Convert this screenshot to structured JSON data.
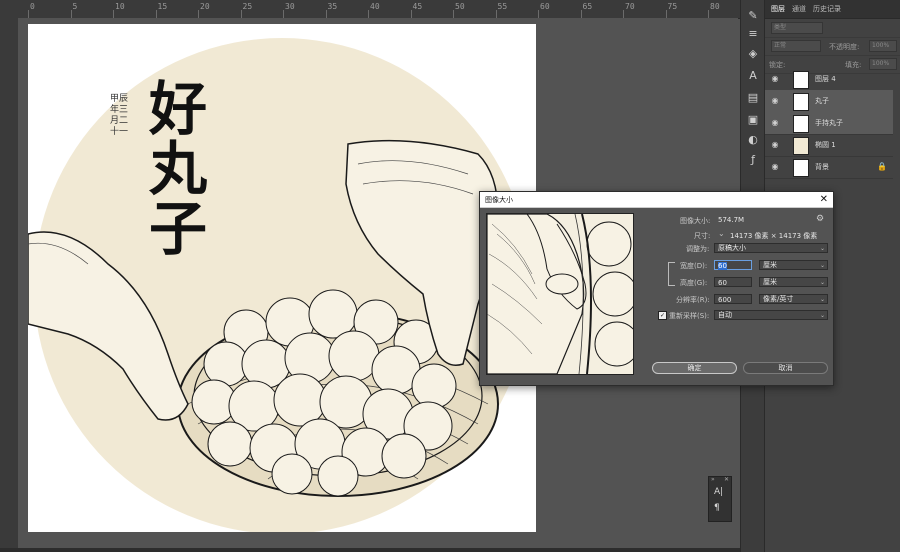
{
  "ruler": {
    "top_numbers": [
      "0",
      "5",
      "10",
      "15",
      "20",
      "25",
      "30",
      "35",
      "40",
      "45",
      "50",
      "55",
      "60",
      "65",
      "70",
      "75",
      "80"
    ]
  },
  "panel": {
    "tabs": [
      "图层",
      "通道",
      "历史记录"
    ],
    "filter_label": "类型",
    "blend_mode": "正常",
    "opacity_label": "不透明度:",
    "opacity_value": "100%",
    "lock_label": "锁定:",
    "fill_label": "填充:",
    "fill_value": "100%",
    "layers": [
      {
        "name": "图层 4",
        "selected": false
      },
      {
        "name": "丸子",
        "selected": true
      },
      {
        "name": "手持丸子",
        "selected": true
      },
      {
        "name": "椭圆 1",
        "selected": false
      },
      {
        "name": "背景",
        "selected": false
      }
    ]
  },
  "artwork": {
    "title": "好丸子",
    "inscription": "甲辰年三月二十一"
  },
  "dialog": {
    "title": "图像大小",
    "image_size_label": "图像大小:",
    "image_size_value": "574.7M",
    "dimensions_label": "尺寸:",
    "dimensions_value": "14173 像素 × 14173 像素",
    "fit_label": "调整为:",
    "fit_value": "原稿大小",
    "width_label": "宽度(D):",
    "width_value": "60",
    "width_unit": "厘米",
    "height_label": "高度(G):",
    "height_value": "60",
    "height_unit": "厘米",
    "resolution_label": "分辨率(R):",
    "resolution_value": "600",
    "resolution_unit": "像素/英寸",
    "resample_label": "重新采样(S):",
    "resample_value": "自动",
    "ok_label": "确定",
    "cancel_label": "取消"
  },
  "colors": {
    "canvas_circle": "#f1e9d4",
    "ink": "#1a1a1a"
  },
  "icons": [
    "eye-icon",
    "chain-link-icon",
    "gear-icon",
    "close-icon",
    "type-icon",
    "paragraph-icon"
  ]
}
